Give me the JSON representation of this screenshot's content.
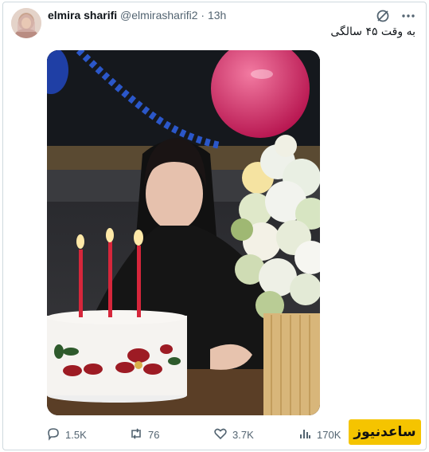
{
  "tweet": {
    "display_name": "elmira sharifi",
    "handle": "@elmirasharifi2",
    "separator": "·",
    "time": "13h",
    "text": "به وقت ۴۵ سالگی"
  },
  "stats": {
    "replies": "1.5K",
    "reposts": "76",
    "likes": "3.7K",
    "views": "170K"
  },
  "watermark": {
    "text": "ساعدنیوز"
  },
  "icons": {
    "header": [
      "grok-icon",
      "more-icon"
    ],
    "actions": [
      "reply-icon",
      "repost-icon",
      "like-icon",
      "views-icon"
    ]
  },
  "colors": {
    "text": "#0f1419",
    "muted": "#536471",
    "border": "#cfd9de",
    "watermark_bg": "#f5c400"
  }
}
